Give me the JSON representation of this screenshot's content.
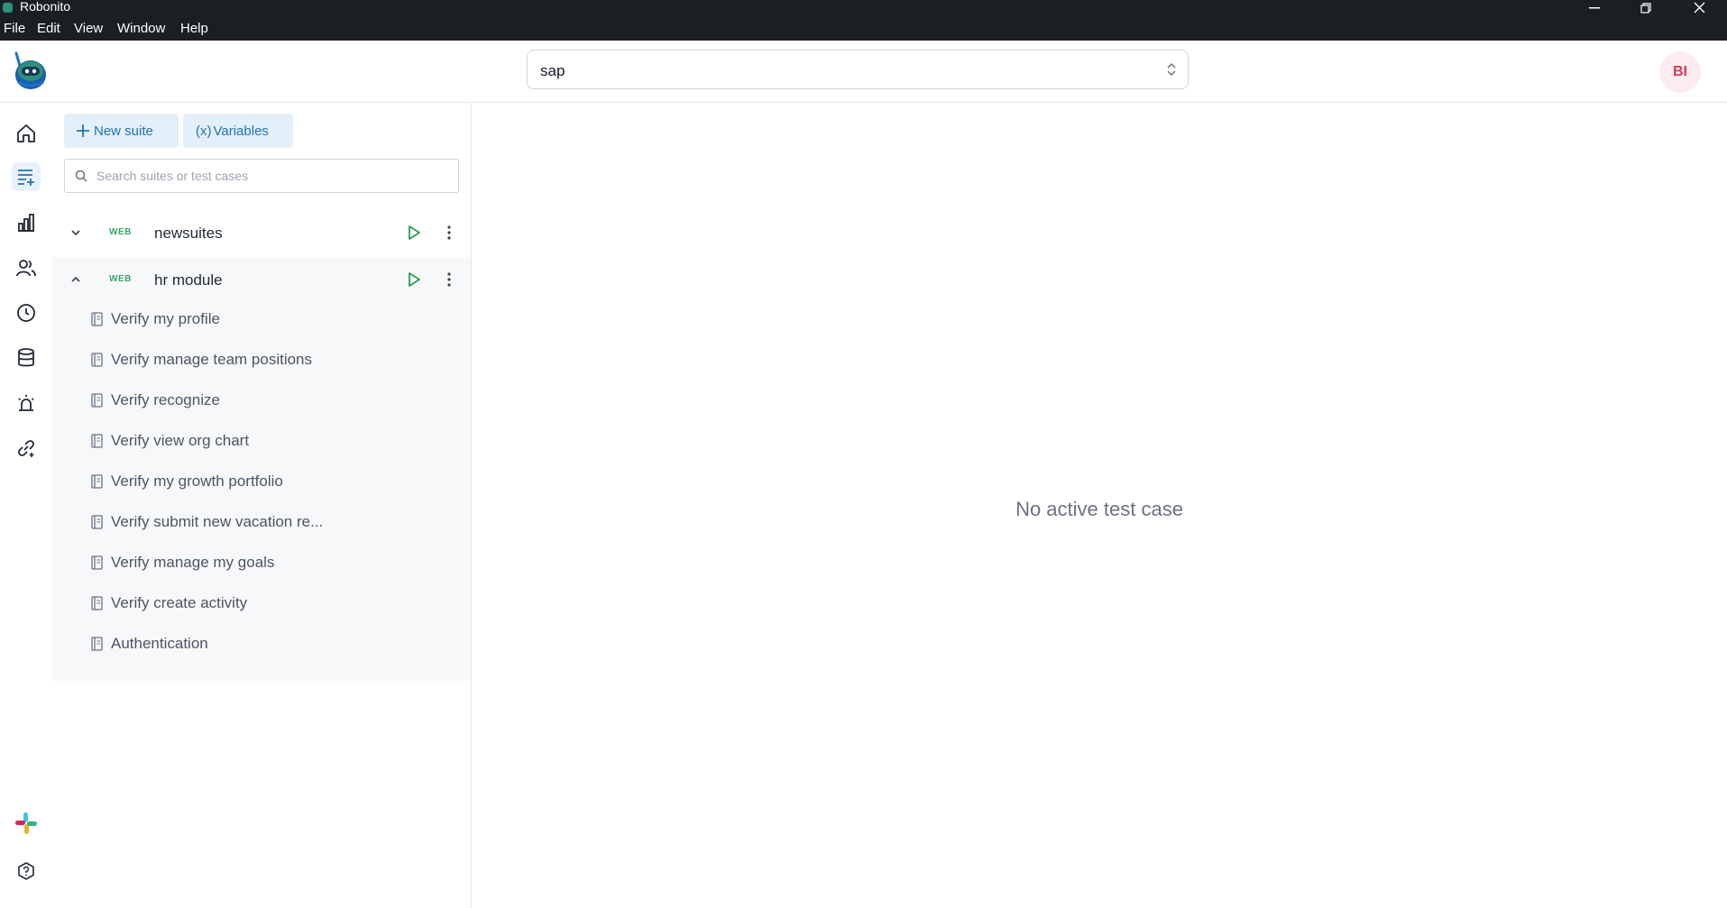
{
  "window": {
    "title": "Robonito"
  },
  "menu": [
    "File",
    "Edit",
    "View",
    "Window",
    "Help"
  ],
  "header": {
    "project_value": "sap",
    "avatar_initials": "BI"
  },
  "nav": [
    {
      "name": "home-icon"
    },
    {
      "name": "test-suites-icon"
    },
    {
      "name": "reports-icon"
    },
    {
      "name": "users-icon"
    },
    {
      "name": "history-icon"
    },
    {
      "name": "database-icon"
    },
    {
      "name": "alerts-icon"
    },
    {
      "name": "integrations-icon"
    }
  ],
  "toolbar": {
    "new_suite_label": "New suite",
    "variables_label": "Variables",
    "variables_symbol": "(x)",
    "search_placeholder": "Search suites or test cases"
  },
  "suites": [
    {
      "tag": "WEB",
      "name": "newsuites",
      "expanded": false
    },
    {
      "tag": "WEB",
      "name": "hr module",
      "expanded": true,
      "cases": [
        "Verify my profile",
        "Verify manage team positions",
        "Verify recognize",
        "Verify view org chart",
        "Verify my growth portfolio",
        "Verify submit new vacation re...",
        "Verify manage my goals",
        "Verify create activity",
        "Authentication"
      ]
    }
  ],
  "main": {
    "empty_message": "No active test case"
  },
  "colors": {
    "accent": "#2274b6",
    "web_tag": "#3aa564",
    "play": "#2e9a4f",
    "avatar_text": "#d23a5a"
  }
}
